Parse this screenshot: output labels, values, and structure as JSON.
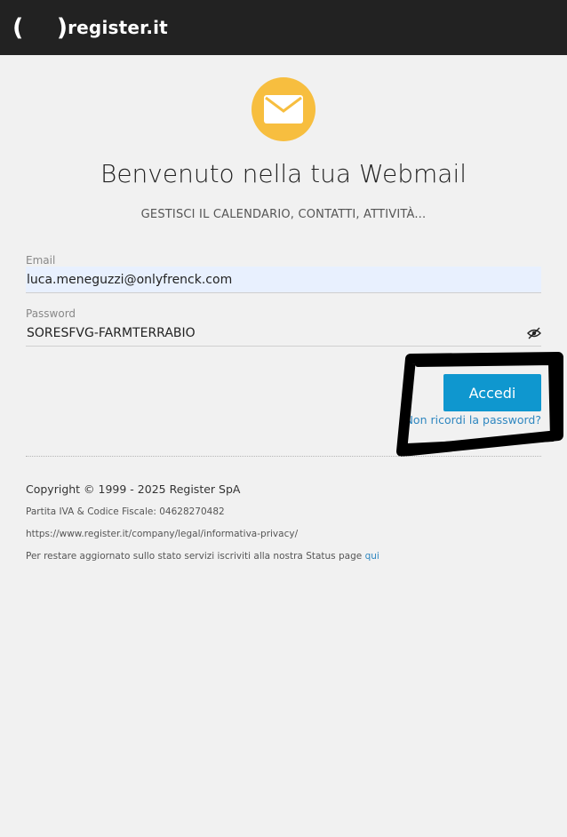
{
  "header": {
    "logo_parens": "( )",
    "logo_text": "register.it"
  },
  "hero": {
    "icon": "envelope-icon",
    "title": "Benvenuto nella tua Webmail",
    "subtitle": "GESTISCI IL CALENDARIO, CONTATTI, ATTIVITÀ..."
  },
  "form": {
    "email_label": "Email",
    "email_value": "luca.meneguzzi@onlyfrenck.com",
    "password_label": "Password",
    "password_value": "SORESFVG-FARMTERRABIO",
    "password_toggle_icon": "eye-slash-icon",
    "submit_label": "Accedi",
    "forgot_label": "Non ricordi la password?"
  },
  "footer": {
    "copyright": "Copyright © 1999 - 2025 Register SpA",
    "vat": "Partita IVA & Codice Fiscale: 04628270482",
    "privacy_url": "https://www.register.it/company/legal/informativa-privacy/",
    "status_text": "Per restare aggiornato sullo stato servizi iscriviti alla nostra Status page ",
    "status_link": "qui"
  },
  "colors": {
    "topbar": "#222222",
    "accent_yellow": "#f7be3f",
    "button_blue": "#0f97cf",
    "link_blue": "#2f87c0",
    "annotation": "#000000"
  }
}
